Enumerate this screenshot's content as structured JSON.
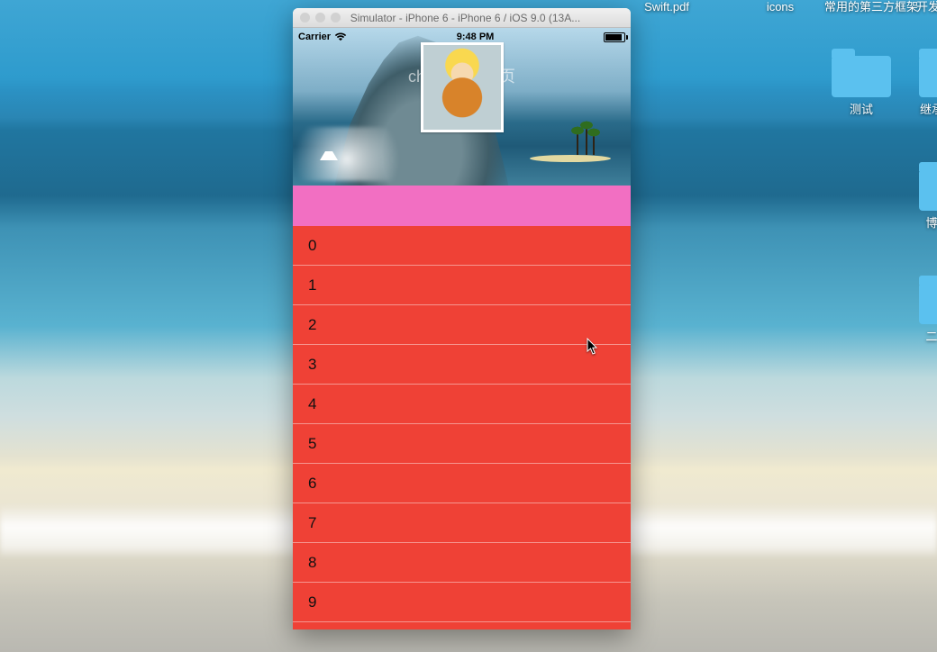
{
  "desktop_icons": {
    "pdf_label": "Swift.pdf",
    "folder1_label": "icons",
    "folder2_label": "常用的第三方框架",
    "folder3_label": "开发",
    "folder4_label": "测试",
    "folder5_label": "继承",
    "folder6_label": "博",
    "folder7_label": "二"
  },
  "simulator": {
    "window_title": "Simulator - iPhone 6 - iPhone 6 / iOS 9.0 (13A...",
    "statusbar": {
      "carrier": "Carrier",
      "time": "9:48 PM"
    },
    "header_caption": "chg的个人主页",
    "rows": [
      "0",
      "1",
      "2",
      "3",
      "4",
      "5",
      "6",
      "7",
      "8",
      "9"
    ]
  }
}
